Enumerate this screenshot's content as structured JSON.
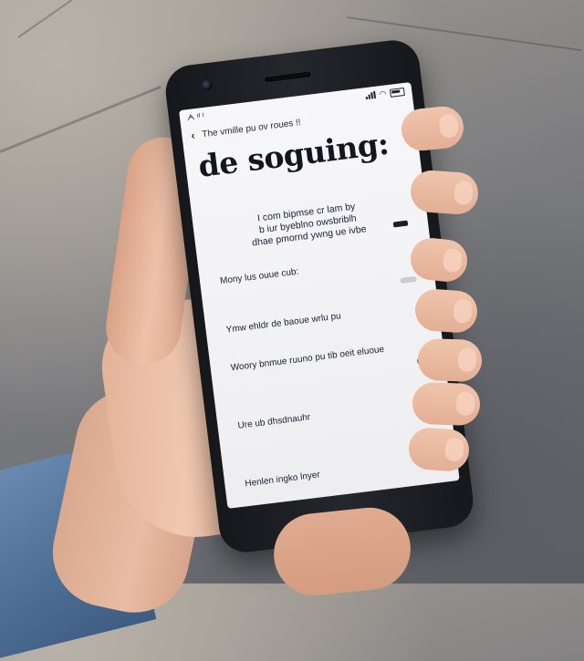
{
  "status_bar": {
    "time": "ᗅ ᵈ ᵗ",
    "icons": [
      "signal-icon",
      "wifi-icon",
      "battery-icon"
    ]
  },
  "app_bar": {
    "back_icon": "back-arrow-icon",
    "heading": "The vmille pu ov roues !!"
  },
  "title": "de soguing:",
  "intro": [
    "I com bipmse cr lam by",
    "b iur byeblno owsbriblh",
    "dhae pmornd ywng ue ivbe"
  ],
  "rows": [
    {
      "label": "Mony lus ouue cub:",
      "control": "light"
    },
    {
      "label": "Ymw ehldr de baoue wrlu pu",
      "control": "none"
    },
    {
      "label": "Woory bnmue ruuno pu tib oeit eluoue",
      "control": "dark"
    },
    {
      "label": "Ure ub dhsdnauhr",
      "control": "none"
    },
    {
      "label": "Henlen ingko lnyer",
      "control": "mark"
    }
  ],
  "colors": {
    "screen_bg": "#f5f5f7",
    "text": "#1b2036",
    "phone_body": "#1a1c20"
  }
}
